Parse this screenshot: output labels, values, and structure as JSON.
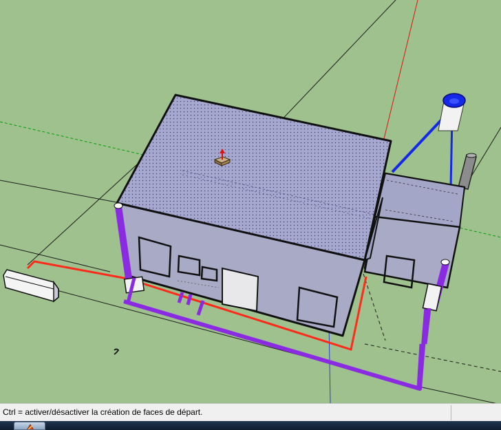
{
  "status_bar": {
    "hint": "Ctrl = activer/désactiver la création de faces de départ."
  },
  "scene": {
    "background_color": "#9ec18e",
    "wall_color": "#a9aac6",
    "roof_color": "#a6a8cf",
    "pipe_color": "#8a2be2",
    "red_line_color": "#ff2a1a",
    "tank_color": "#1428e8"
  },
  "taskbar": {
    "app_icon": "sketchup-icon"
  }
}
